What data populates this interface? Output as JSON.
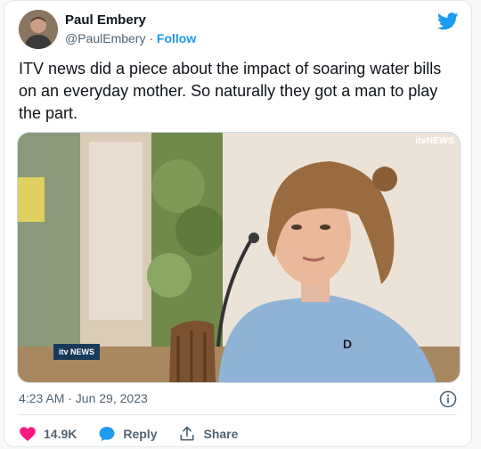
{
  "author": {
    "name": "Paul Embery",
    "handle": "@PaulEmbery",
    "separator": "·",
    "follow_label": "Follow"
  },
  "tweet": {
    "text": "ITV news did a piece about the impact of soaring water bills on an everyday mother. So naturally they got a man to play the part."
  },
  "media": {
    "watermark": "itvNEWS",
    "lower_third": "itv NEWS"
  },
  "meta": {
    "timestamp": "4:23 AM · Jun 29, 2023"
  },
  "actions": {
    "like_count": "14.9K",
    "reply_label": "Reply",
    "share_label": "Share"
  },
  "colors": {
    "accent": "#1d9bf0",
    "like": "#f91880",
    "text": "#0f1419",
    "muted": "#536471"
  },
  "icons": {
    "brand": "twitter-bird-icon",
    "like": "heart-icon",
    "reply": "speech-bubble-icon",
    "share": "share-arrow-icon",
    "info": "info-icon"
  }
}
